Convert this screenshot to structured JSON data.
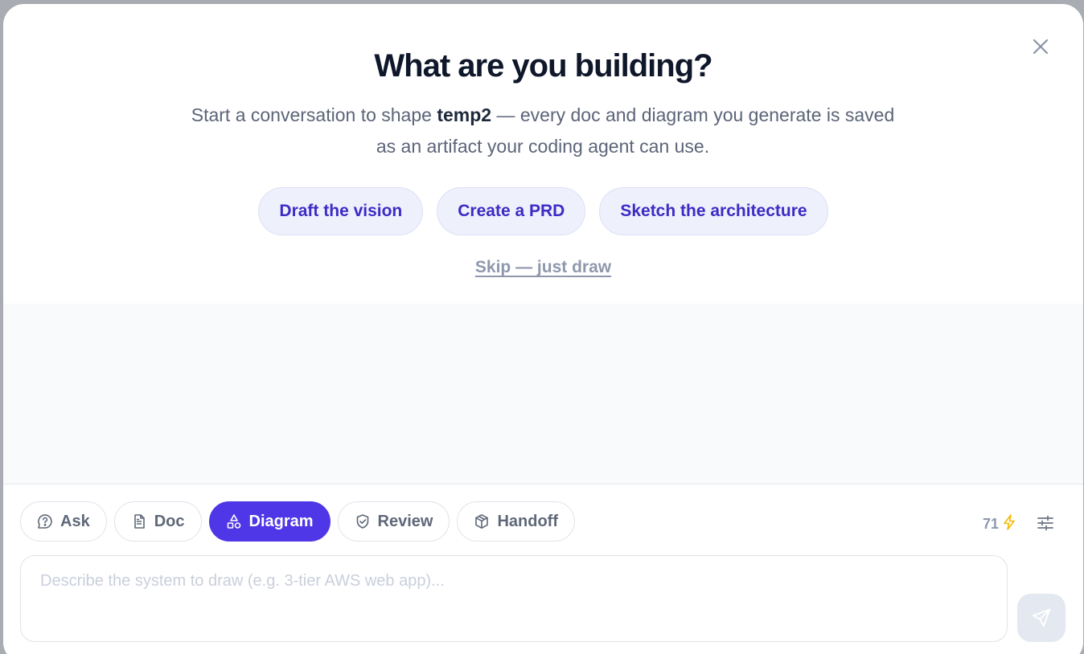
{
  "header": {
    "title": "What are you building?",
    "subtitle_before": "Start a conversation to shape ",
    "project_name": "temp2",
    "subtitle_after": " — every doc and diagram you generate is saved as an artifact your coding agent can use."
  },
  "quick_actions": [
    {
      "label": "Draft the vision"
    },
    {
      "label": "Create a PRD"
    },
    {
      "label": "Sketch the architecture"
    }
  ],
  "skip_label": "Skip — just draw",
  "modes": [
    {
      "label": "Ask",
      "icon": "help-circle-icon",
      "active": false
    },
    {
      "label": "Doc",
      "icon": "document-icon",
      "active": false
    },
    {
      "label": "Diagram",
      "icon": "shapes-icon",
      "active": true
    },
    {
      "label": "Review",
      "icon": "shield-check-icon",
      "active": false
    },
    {
      "label": "Handoff",
      "icon": "package-icon",
      "active": false
    }
  ],
  "credits": {
    "count": "71",
    "icon": "lightning-icon"
  },
  "composer": {
    "placeholder": "Describe the system to draw (e.g. 3-tier AWS web app)...",
    "value": ""
  },
  "colors": {
    "accent": "#4f36e6",
    "chip_text": "#3d2bc4",
    "chip_bg": "#eef0fc",
    "credits_bolt": "#f5b800"
  }
}
